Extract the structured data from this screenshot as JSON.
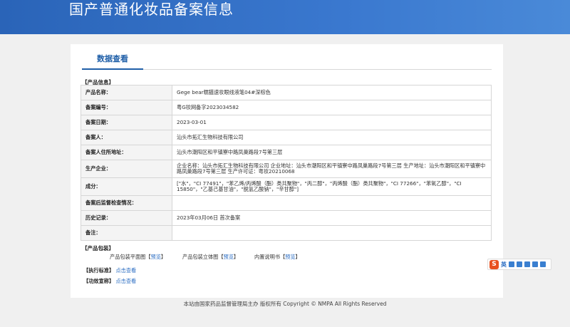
{
  "header": {
    "title": "国产普通化妆品备案信息"
  },
  "tab": {
    "label": "数据查看"
  },
  "sections": {
    "product_info": "【产品信息】",
    "product_pack": "【产品包装】"
  },
  "rows": [
    {
      "label": "产品名称：",
      "value": "Gege bear糯猫速妆眼线液笔04#深棕色"
    },
    {
      "label": "备案编号：",
      "value": "粤G妆网备字2023034582"
    },
    {
      "label": "备案日期：",
      "value": "2023-03-01"
    },
    {
      "label": "备案人：",
      "value": "汕头市拓汇生物科技有限公司"
    },
    {
      "label": "备案人住所地址：",
      "value": "汕头市潮阳区和平镇寮中路凤巢路段7号第三层"
    },
    {
      "label": "生产企业：",
      "value": "企业名称：汕头市拓汇生物科技有限公司 企业地址：汕头市潮阳区和平镇寮中路凤巢路段7号第三层 生产地址：汕头市潮阳区和平镇寮中路凤巢路段7号第三层 生产许可证：粤妆20210068"
    },
    {
      "label": "成分：",
      "value": "[\"水\"，\"CI 77491\"，\"苯乙烯/丙烯酸（酯）类共聚物\"，\"丙二醇\"，\"丙烯酸（酯）类共聚物\"，\"CI 77266\"，\"苯氧乙醇\"，\"CI 15850\"，\"乙基己基甘油\"，\"脱氢乙酸钠\"，\"辛甘醇\"]"
    },
    {
      "label": "备案后监督检查情况：",
      "value": ""
    },
    {
      "label": "历史记录：",
      "value": "2023年03月06日 首次备案"
    },
    {
      "label": "备注：",
      "value": ""
    }
  ],
  "package": {
    "items": [
      {
        "name": "产品包装平面图",
        "link": "预览"
      },
      {
        "name": "产品包装立体图",
        "link": "预览"
      },
      {
        "name": "内置说明书",
        "link": "预览"
      }
    ]
  },
  "standards": {
    "label": "【执行标准】",
    "link": "点击查看"
  },
  "efficacy": {
    "label": "【功效宣称】",
    "link": "点击查看"
  },
  "footer": {
    "text": "本站由国家药品监督管理局主办 版权所有 Copyright © NMPA All Rights Reserved"
  },
  "ime": {
    "logo": "S",
    "lang": "英"
  }
}
